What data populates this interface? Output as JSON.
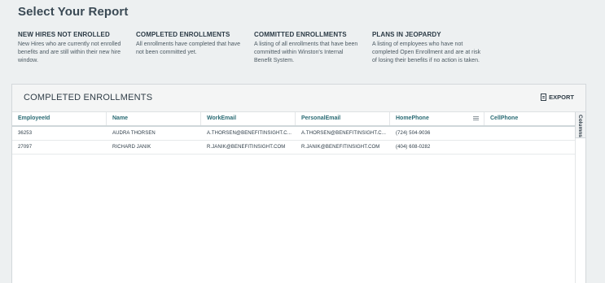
{
  "page": {
    "title": "Select Your Report"
  },
  "reports": [
    {
      "title": "NEW HIRES NOT ENROLLED",
      "description": "New Hires who are currently not enrolled benefits and are still within their new hire window."
    },
    {
      "title": "COMPLETED ENROLLMENTS",
      "description": "All enrollments have completed that have not been committed yet."
    },
    {
      "title": "COMMITTED ENROLLMENTS",
      "description": "A listing of all enrollments that have been committed within Winston's Internal Benefit System."
    },
    {
      "title": "PLANS IN JEOPARDY",
      "description": "A listing of employees who have not completed Open Enrollment and are at risk of losing their benefits if no action is taken."
    }
  ],
  "panel": {
    "title": "COMPLETED ENROLLMENTS",
    "export_label": "EXPORT",
    "export_icon": "export-document-icon",
    "columns_tab": "Columns"
  },
  "table": {
    "columns": [
      "EmployeeId",
      "Name",
      "WorkEmail",
      "PersonalEmail",
      "HomePhone",
      "CellPhone"
    ],
    "rows": [
      [
        "36253",
        "AUDRA THORSEN",
        "A.THORSEN@BENEFITINSIGHT.C...",
        "A.THORSEN@BENEFITINSIGHT.C...",
        "(724) 504-9036",
        ""
      ],
      [
        "27097",
        "RICHARD JANIK",
        "R.JANIK@BENEFITINSIGHT.COM",
        "R.JANIK@BENEFITINSIGHT.COM",
        "(404) 608-0282",
        ""
      ]
    ]
  },
  "colors": {
    "header_text": "#2a6b74",
    "background": "#edf0f1"
  }
}
